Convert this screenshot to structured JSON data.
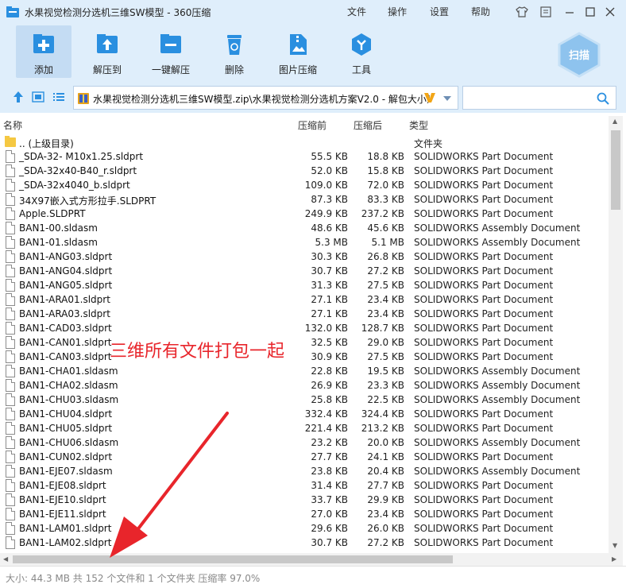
{
  "window": {
    "title": "水果视觉检测分选机三维SW模型 - 360压缩",
    "menu": [
      "文件",
      "操作",
      "设置",
      "帮助"
    ]
  },
  "toolbar": {
    "add": "添加",
    "extract_to": "解压到",
    "one_click_extract": "一键解压",
    "delete": "删除",
    "image_compress": "图片压缩",
    "tools": "工具",
    "scan": "扫描"
  },
  "address": {
    "path": "水果视觉检测分选机三维SW模型.zip\\水果视觉检测分选机方案V2.0 - 解包大小为"
  },
  "columns": {
    "name": "名称",
    "size": "压缩前",
    "packed": "压缩后",
    "type": "类型"
  },
  "rows": [
    {
      "name": ".. (上级目录)",
      "size": "",
      "packed": "",
      "type": "文件夹",
      "folder": true
    },
    {
      "name": "_SDA-32-  M10x1.25.sldprt",
      "size": "55.5 KB",
      "packed": "18.8 KB",
      "type": "SOLIDWORKS Part Document"
    },
    {
      "name": "_SDA-32x40-B40_r.sldprt",
      "size": "52.0 KB",
      "packed": "15.8 KB",
      "type": "SOLIDWORKS Part Document"
    },
    {
      "name": "_SDA-32x4040_b.sldprt",
      "size": "109.0 KB",
      "packed": "72.0 KB",
      "type": "SOLIDWORKS Part Document"
    },
    {
      "name": "34X97嵌入式方形拉手.SLDPRT",
      "size": "87.3 KB",
      "packed": "83.3 KB",
      "type": "SOLIDWORKS Part Document"
    },
    {
      "name": "Apple.SLDPRT",
      "size": "249.9 KB",
      "packed": "237.2 KB",
      "type": "SOLIDWORKS Part Document"
    },
    {
      "name": "BAN1-00.sldasm",
      "size": "48.6 KB",
      "packed": "45.6 KB",
      "type": "SOLIDWORKS Assembly Document"
    },
    {
      "name": "BAN1-01.sldasm",
      "size": "5.3 MB",
      "packed": "5.1 MB",
      "type": "SOLIDWORKS Assembly Document"
    },
    {
      "name": "BAN1-ANG03.sldprt",
      "size": "30.3 KB",
      "packed": "26.8 KB",
      "type": "SOLIDWORKS Part Document"
    },
    {
      "name": "BAN1-ANG04.sldprt",
      "size": "30.7 KB",
      "packed": "27.2 KB",
      "type": "SOLIDWORKS Part Document"
    },
    {
      "name": "BAN1-ANG05.sldprt",
      "size": "31.3 KB",
      "packed": "27.5 KB",
      "type": "SOLIDWORKS Part Document"
    },
    {
      "name": "BAN1-ARA01.sldprt",
      "size": "27.1 KB",
      "packed": "23.4 KB",
      "type": "SOLIDWORKS Part Document"
    },
    {
      "name": "BAN1-ARA03.sldprt",
      "size": "27.1 KB",
      "packed": "23.4 KB",
      "type": "SOLIDWORKS Part Document"
    },
    {
      "name": "BAN1-CAD03.sldprt",
      "size": "132.0 KB",
      "packed": "128.7 KB",
      "type": "SOLIDWORKS Part Document"
    },
    {
      "name": "BAN1-CAN01.sldprt",
      "size": "32.5 KB",
      "packed": "29.0 KB",
      "type": "SOLIDWORKS Part Document"
    },
    {
      "name": "BAN1-CAN03.sldprt",
      "size": "30.9 KB",
      "packed": "27.5 KB",
      "type": "SOLIDWORKS Part Document"
    },
    {
      "name": "BAN1-CHA01.sldasm",
      "size": "22.8 KB",
      "packed": "19.5 KB",
      "type": "SOLIDWORKS Assembly Document"
    },
    {
      "name": "BAN1-CHA02.sldasm",
      "size": "26.9 KB",
      "packed": "23.3 KB",
      "type": "SOLIDWORKS Assembly Document"
    },
    {
      "name": "BAN1-CHU03.sldasm",
      "size": "25.8 KB",
      "packed": "22.5 KB",
      "type": "SOLIDWORKS Assembly Document"
    },
    {
      "name": "BAN1-CHU04.sldprt",
      "size": "332.4 KB",
      "packed": "324.4 KB",
      "type": "SOLIDWORKS Part Document"
    },
    {
      "name": "BAN1-CHU05.sldprt",
      "size": "221.4 KB",
      "packed": "213.2 KB",
      "type": "SOLIDWORKS Part Document"
    },
    {
      "name": "BAN1-CHU06.sldasm",
      "size": "23.2 KB",
      "packed": "20.0 KB",
      "type": "SOLIDWORKS Assembly Document"
    },
    {
      "name": "BAN1-CUN02.sldprt",
      "size": "27.7 KB",
      "packed": "24.1 KB",
      "type": "SOLIDWORKS Part Document"
    },
    {
      "name": "BAN1-EJE07.sldasm",
      "size": "23.8 KB",
      "packed": "20.4 KB",
      "type": "SOLIDWORKS Assembly Document"
    },
    {
      "name": "BAN1-EJE08.sldprt",
      "size": "31.4 KB",
      "packed": "27.7 KB",
      "type": "SOLIDWORKS Part Document"
    },
    {
      "name": "BAN1-EJE10.sldprt",
      "size": "33.7 KB",
      "packed": "29.9 KB",
      "type": "SOLIDWORKS Part Document"
    },
    {
      "name": "BAN1-EJE11.sldprt",
      "size": "27.0 KB",
      "packed": "23.4 KB",
      "type": "SOLIDWORKS Part Document"
    },
    {
      "name": "BAN1-LAM01.sldprt",
      "size": "29.6 KB",
      "packed": "26.0 KB",
      "type": "SOLIDWORKS Part Document"
    },
    {
      "name": "BAN1-LAM02.sldprt",
      "size": "30.7 KB",
      "packed": "27.2 KB",
      "type": "SOLIDWORKS Part Document"
    }
  ],
  "status": {
    "text": "大小: 44.3 MB 共 152 个文件和 1 个文件夹 压缩率 97.0%"
  },
  "annotation": {
    "text": "三维所有文件打包一起",
    "color": "#e8252b"
  },
  "colors": {
    "chrome": "#dfeefb",
    "icon_blue": "#2a8fe0"
  }
}
